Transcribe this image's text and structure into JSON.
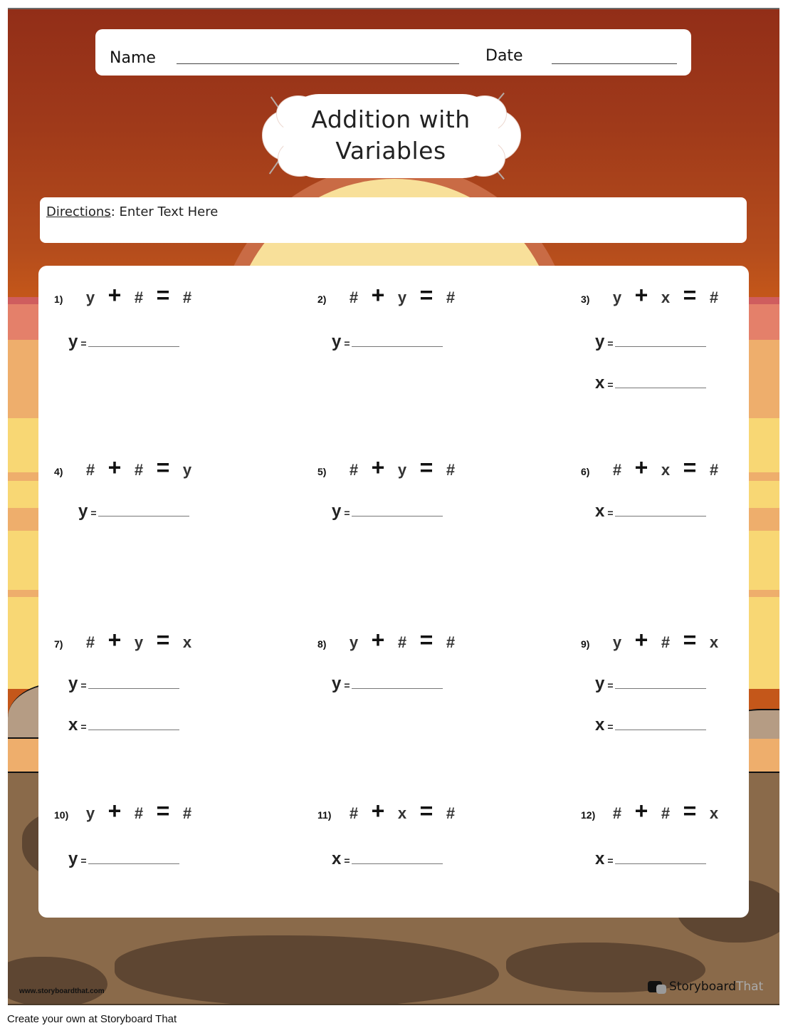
{
  "header": {
    "name_label": "Name",
    "date_label": "Date",
    "title_line1": "Addition with",
    "title_line2": "Variables"
  },
  "directions": {
    "label": "Directions",
    "text": ": Enter Text Here"
  },
  "problems": [
    {
      "num": "1)",
      "tokens": [
        "y",
        "+",
        "#",
        "=",
        "#"
      ],
      "answers": [
        "y"
      ]
    },
    {
      "num": "2)",
      "tokens": [
        "#",
        "+",
        "y",
        "=",
        "#"
      ],
      "answers": [
        "y"
      ]
    },
    {
      "num": "3)",
      "tokens": [
        "y",
        "+",
        "x",
        "=",
        "#"
      ],
      "answers": [
        "y",
        "x"
      ]
    },
    {
      "num": "4)",
      "tokens": [
        "#",
        "+",
        "#",
        "=",
        "y"
      ],
      "answers": [
        "y"
      ]
    },
    {
      "num": "5)",
      "tokens": [
        "#",
        "+",
        "y",
        "=",
        "#"
      ],
      "answers": [
        "y"
      ]
    },
    {
      "num": "6)",
      "tokens": [
        "#",
        "+",
        "x",
        "=",
        "#"
      ],
      "answers": [
        "x"
      ]
    },
    {
      "num": "7)",
      "tokens": [
        "#",
        "+",
        "y",
        "=",
        "x"
      ],
      "answers": [
        "y",
        "x"
      ]
    },
    {
      "num": "8)",
      "tokens": [
        "y",
        "+",
        "#",
        "=",
        "#"
      ],
      "answers": [
        "y"
      ]
    },
    {
      "num": "9)",
      "tokens": [
        "y",
        "+",
        "#",
        "=",
        "x"
      ],
      "answers": [
        "y",
        "x"
      ]
    },
    {
      "num": "10)",
      "tokens": [
        "y",
        "+",
        "#",
        "=",
        "#"
      ],
      "answers": [
        "y"
      ]
    },
    {
      "num": "11)",
      "tokens": [
        "#",
        "+",
        "x",
        "=",
        "#"
      ],
      "answers": [
        "x"
      ]
    },
    {
      "num": "12)",
      "tokens": [
        "#",
        "+",
        "#",
        "=",
        "x"
      ],
      "answers": [
        "x"
      ]
    }
  ],
  "answer_equals": "=",
  "footer": {
    "url": "www.storyboardthat.com",
    "logo_part1": "Storyboard",
    "logo_part2": "That",
    "credit": "Create your own at Storyboard That"
  },
  "colors": {
    "sky_top": "#922e18",
    "sky_bottom": "#c4571a",
    "sun": "#f8e09a",
    "ground": "#8a6a4a",
    "ground_dark": "#5e4632"
  }
}
